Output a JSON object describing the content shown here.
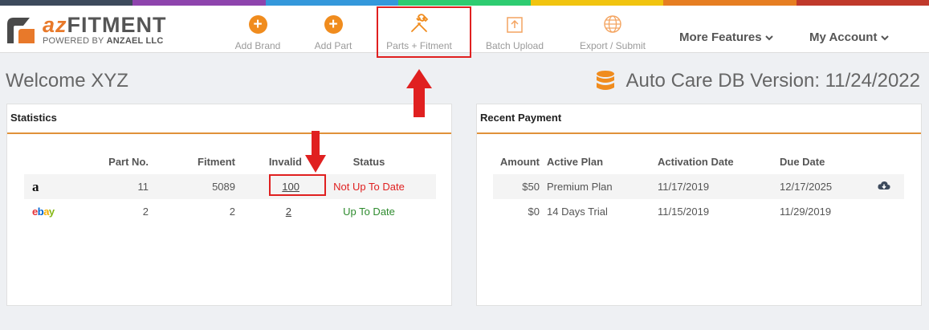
{
  "colors": {
    "accent": "#f08c1e",
    "highlight": "#e02020",
    "status_bad": "#e02020",
    "status_good": "#2e8b2e",
    "top_bar": [
      "#3d4a5c",
      "#8e44ad",
      "#3498db",
      "#2ecc71",
      "#f1c40f",
      "#e67e22",
      "#c0392b"
    ]
  },
  "logo": {
    "brand_az": "az",
    "brand_fitment": "FITMENT",
    "powered_prefix": "POWERED BY ",
    "powered_company": "ANZAEL LLC"
  },
  "nav": {
    "items": [
      {
        "label": "Add Brand",
        "icon": "plus-circle-icon"
      },
      {
        "label": "Add Part",
        "icon": "plus-circle-icon"
      },
      {
        "label": "Parts + Fitment",
        "icon": "wrench-screwdriver-icon"
      },
      {
        "label": "Batch Upload",
        "icon": "upload-icon"
      },
      {
        "label": "Export / Submit",
        "icon": "globe-icon"
      }
    ],
    "menus": [
      {
        "label": "More Features",
        "icon": "chevron-down-icon"
      },
      {
        "label": "My Account",
        "icon": "chevron-down-icon"
      }
    ]
  },
  "header": {
    "welcome": "Welcome XYZ",
    "version": "Auto Care DB Version: 11/24/2022"
  },
  "statistics": {
    "title": "Statistics",
    "columns": [
      "Part No.",
      "Fitment",
      "Invalid",
      "Status"
    ],
    "rows": [
      {
        "logo": "a",
        "part_no": "11",
        "fitment": "5089",
        "invalid": "100",
        "status": "Not Up To Date"
      },
      {
        "logo": "ebay",
        "part_no": "2",
        "fitment": "2",
        "invalid": "2",
        "status": "Up To Date"
      }
    ]
  },
  "payments": {
    "title": "Recent Payment",
    "columns": [
      "Amount",
      "Active Plan",
      "Activation Date",
      "Due Date"
    ],
    "rows": [
      {
        "amount": "$50",
        "plan": "Premium Plan",
        "activation": "11/17/2019",
        "due": "12/17/2025",
        "icon": "cloud-download-icon"
      },
      {
        "amount": "$0",
        "plan": "14 Days Trial",
        "activation": "11/15/2019",
        "due": "11/29/2019"
      }
    ]
  }
}
